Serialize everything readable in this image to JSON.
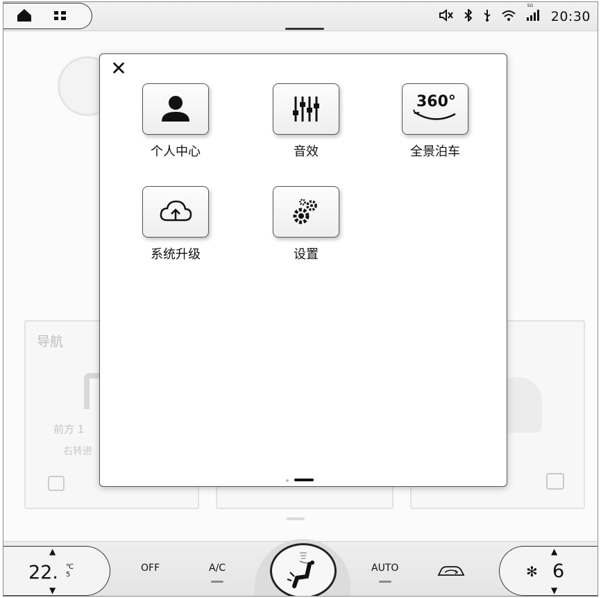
{
  "status_bar": {
    "time": "20:30",
    "signal_label": "5G",
    "icons": [
      "home-icon",
      "apps-icon",
      "mute-icon",
      "bluetooth-icon",
      "usb-icon",
      "wifi-icon",
      "signal-icon"
    ]
  },
  "background": {
    "nav_card_title": "导航",
    "nav_front": "前方 1",
    "nav_turn": "右转进"
  },
  "modal": {
    "close_glyph": "✕",
    "apps": [
      {
        "label": "个人中心",
        "icon": "person-icon"
      },
      {
        "label": "音效",
        "icon": "equalizer-icon"
      },
      {
        "label": "全景泊车",
        "icon": "panorama-360-icon",
        "icon_text": "360°"
      },
      {
        "label": "系统升级",
        "icon": "cloud-upload-icon"
      },
      {
        "label": "设置",
        "icon": "gears-icon"
      }
    ]
  },
  "climate": {
    "temperature_value": "22.",
    "temperature_unit_top": "℃",
    "temperature_unit_bottom": "5",
    "up_glyph": "▲",
    "down_glyph": "▼",
    "off_label": "OFF",
    "ac_label": "A/C",
    "auto_label": "AUTO",
    "fan_glyph": "✻",
    "fan_speed": "6"
  }
}
